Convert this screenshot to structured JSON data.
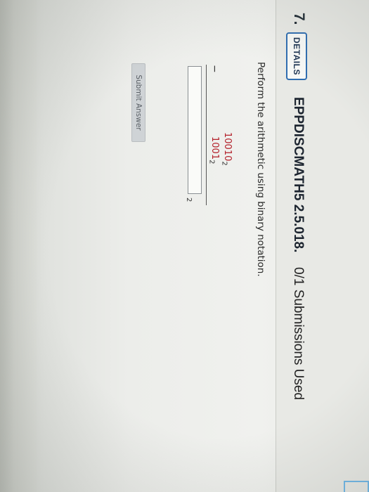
{
  "question": {
    "number": "7.",
    "details_label": "DETAILS",
    "code": "EPPDISCMATH5 2.5.018.",
    "submissions": "0/1 Submissions Used",
    "prompt": "Perform the arithmetic using binary notation.",
    "operand1": {
      "digits": "10010",
      "base": "2"
    },
    "operand2": {
      "digits": "1001",
      "base": "2"
    },
    "operator": "−",
    "answer": {
      "value": "",
      "base": "2"
    },
    "submit_label": "Submit Answer"
  },
  "colors": {
    "details_border": "#2f6db0",
    "operand_digits": "#b3202a",
    "corner_frame": "#6bb5e8"
  }
}
